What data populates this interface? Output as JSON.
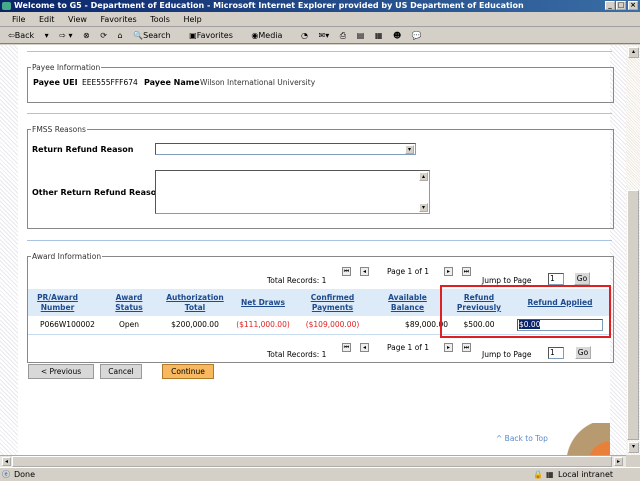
{
  "window": {
    "title": "Welcome to G5 - Department of Education - Microsoft Internet Explorer provided by US Department of Education"
  },
  "menu": [
    "File",
    "Edit",
    "View",
    "Favorites",
    "Tools",
    "Help"
  ],
  "toolbar": {
    "back": "Back",
    "search": "Search",
    "favorites": "Favorites",
    "media": "Media"
  },
  "payee": {
    "legend": "Payee Information",
    "uei_label": "Payee UEI",
    "uei": "EEE555FFF674",
    "name_label": "Payee Name",
    "name": "Wilson International University"
  },
  "fmss": {
    "legend": "FMSS Reasons",
    "reason_label": "Return Refund Reason",
    "reason_value": "",
    "other_label": "Other Return Refund Reason",
    "other_value": ""
  },
  "award": {
    "legend": "Award Information",
    "total_records": "Total Records: 1",
    "page": "Page 1 of 1",
    "jump_label": "Jump to Page",
    "jump_value": "1",
    "go": "Go",
    "columns": [
      {
        "l1": "PR/Award",
        "l2": "Number"
      },
      {
        "l1": "Award",
        "l2": "Status"
      },
      {
        "l1": "Authorization",
        "l2": "Total"
      },
      {
        "l1": "Net Draws",
        "l2": ""
      },
      {
        "l1": "Confirmed",
        "l2": "Payments"
      },
      {
        "l1": "Available",
        "l2": "Balance"
      },
      {
        "l1": "Refund",
        "l2": "Previously"
      },
      {
        "l1": "Refund Applied",
        "l2": ""
      }
    ],
    "row": {
      "award_number": "P066W100002",
      "status": "Open",
      "authorization_total": "$200,000.00",
      "net_draws": "($111,000.00)",
      "confirmed_payments": "($109,000.00)",
      "available_balance": "$89,000.00",
      "refund_previously": "$500.00",
      "refund_applied": "$0.00"
    }
  },
  "buttons": {
    "previous": "< Previous",
    "cancel": "Cancel",
    "continue": "Continue"
  },
  "back_to_top": "^ Back to Top",
  "status": {
    "text": "Done",
    "zone": "Local intranet"
  },
  "colors": {
    "highlight_box": "#e02020",
    "link": "#1e4a8e",
    "negative": "#e02020",
    "continue_button": "#f7b860"
  }
}
